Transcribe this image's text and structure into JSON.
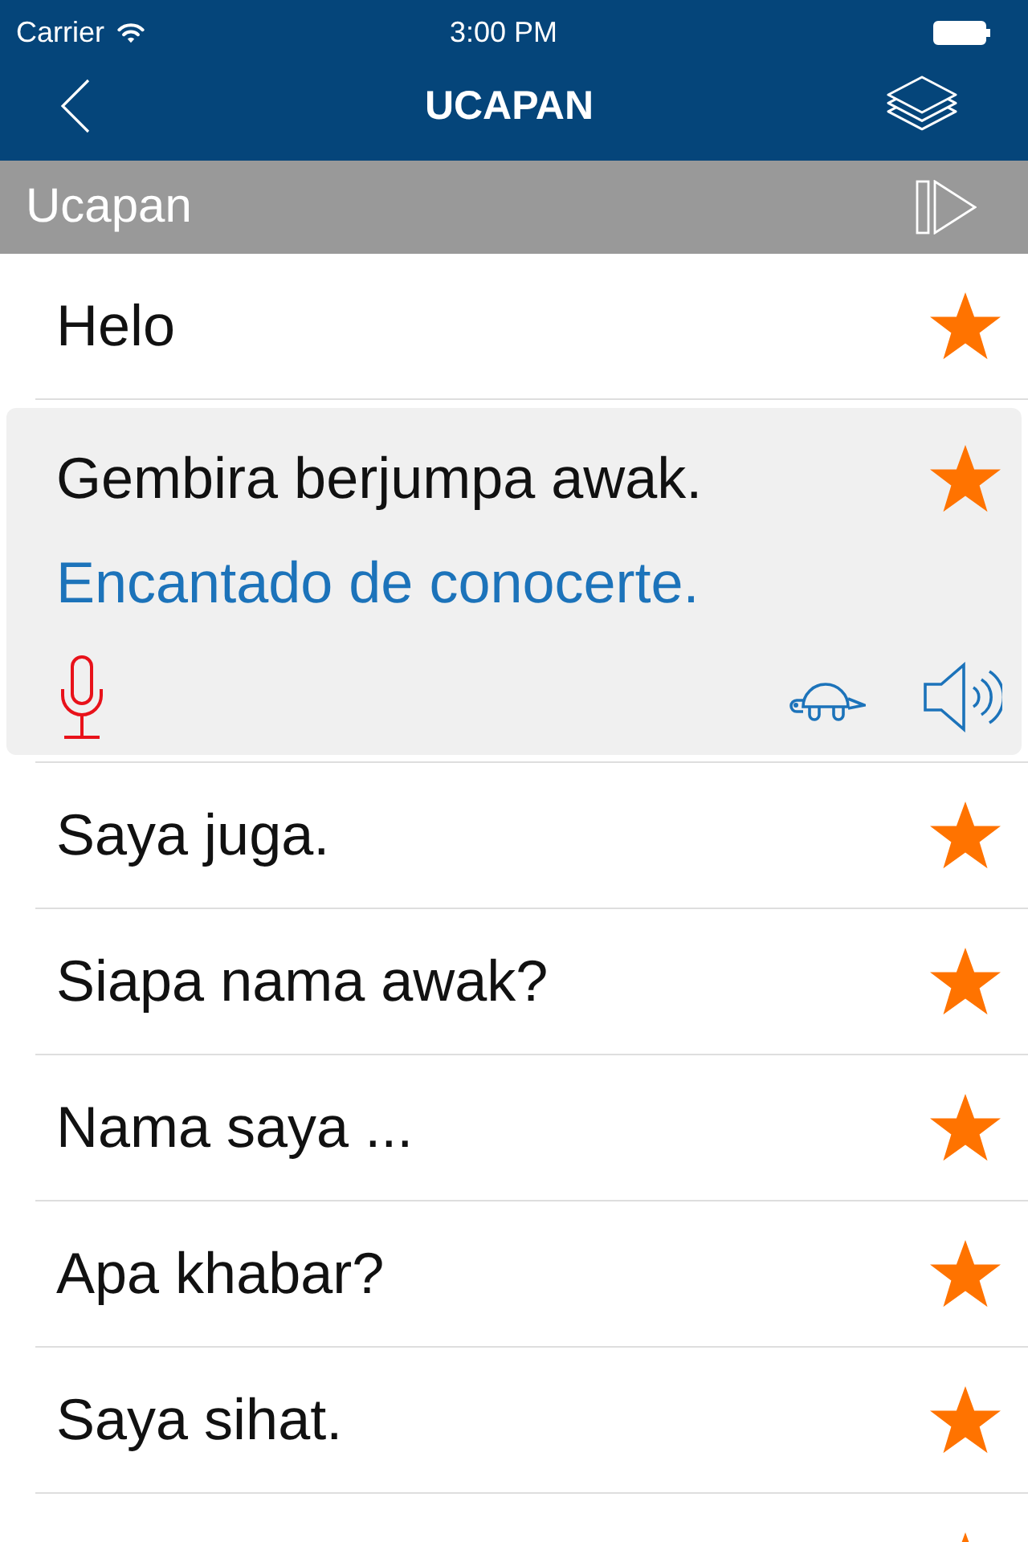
{
  "status_bar": {
    "carrier": "Carrier",
    "time": "3:00 PM"
  },
  "nav_bar": {
    "title": "UCAPAN"
  },
  "section": {
    "title": "Ucapan"
  },
  "phrases": [
    {
      "text": "Helo",
      "starred": true,
      "expanded": false
    },
    {
      "text": "Gembira berjumpa awak.",
      "translation": "Encantado de conocerte.",
      "starred": true,
      "expanded": true
    },
    {
      "text": "Saya juga.",
      "starred": true,
      "expanded": false
    },
    {
      "text": "Siapa nama awak?",
      "starred": true,
      "expanded": false
    },
    {
      "text": "Nama saya ...",
      "starred": true,
      "expanded": false
    },
    {
      "text": "Apa khabar?",
      "starred": true,
      "expanded": false
    },
    {
      "text": "Saya sihat.",
      "starred": true,
      "expanded": false
    },
    {
      "starred": true,
      "expanded": false
    }
  ]
}
